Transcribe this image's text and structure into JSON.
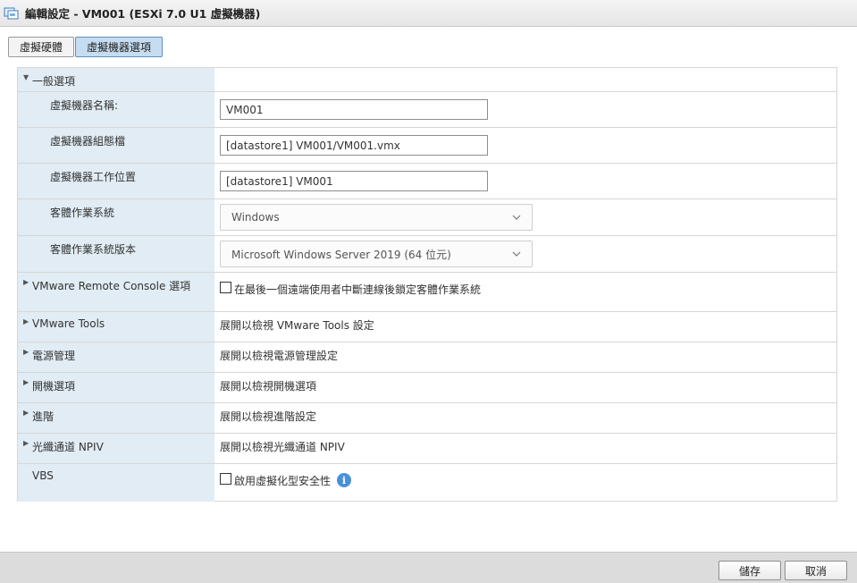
{
  "window": {
    "title": "編輯設定 - VM001 (ESXi 7.0 U1 虛擬機器)"
  },
  "tabs": [
    {
      "label": "虛擬硬體",
      "active": false
    },
    {
      "label": "虛擬機器選項",
      "active": true
    }
  ],
  "general": {
    "section_label": "一般選項",
    "vm_name_label": "虛擬機器名稱:",
    "vm_name_value": "VM001",
    "config_file_label": "虛擬機器組態檔",
    "config_file_value": "[datastore1] VM001/VM001.vmx",
    "working_location_label": "虛擬機器工作位置",
    "working_location_value": "[datastore1] VM001",
    "guest_os_label": "客體作業系統",
    "guest_os_value": "Windows",
    "guest_os_version_label": "客體作業系統版本",
    "guest_os_version_value": "Microsoft Windows Server 2019 (64 位元)"
  },
  "sections": {
    "vmrc_label": "VMware Remote Console 選項",
    "vmrc_checkbox_text": "在最後一個遠端使用者中斷連線後鎖定客體作業系統",
    "vmrc_checked": false,
    "tools_label": "VMware Tools",
    "tools_value": "展開以檢視 VMware Tools 設定",
    "power_label": "電源管理",
    "power_value": "展開以檢視電源管理設定",
    "boot_label": "開機選項",
    "boot_value": "展開以檢視開機選項",
    "advanced_label": "進階",
    "advanced_value": "展開以檢視進階設定",
    "npiv_label": "光纖通道 NPIV",
    "npiv_value": "展開以檢視光纖通道 NPIV",
    "vbs_label": "VBS",
    "vbs_checkbox_text": "啟用虛擬化型安全性",
    "vbs_checked": false
  },
  "footer": {
    "save_label": "儲存",
    "cancel_label": "取消"
  },
  "colors": {
    "label_bg": "#e1ecf4",
    "active_tab": "#c6dcf1",
    "info_icon": "#4a90d9"
  }
}
